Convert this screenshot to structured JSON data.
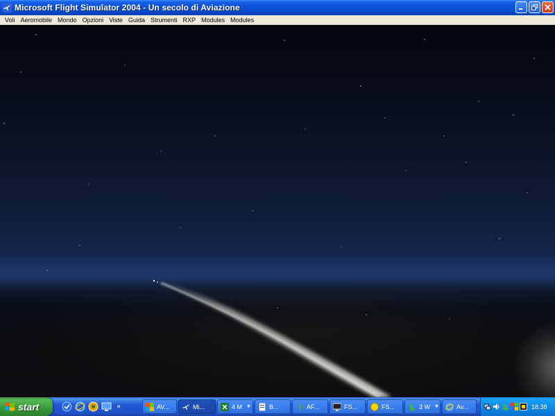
{
  "window": {
    "title": "Microsoft Flight Simulator 2004 - Un secolo di Aviazione",
    "icon": "flight-sim-icon",
    "controls": [
      "minimize-icon",
      "restore-icon",
      "close-icon"
    ]
  },
  "menu": {
    "items": [
      {
        "label": "Voli"
      },
      {
        "label": "Aeromobile"
      },
      {
        "label": "Mondo"
      },
      {
        "label": "Opzioni"
      },
      {
        "label": "Viste"
      },
      {
        "label": "Guida"
      },
      {
        "label": "Strumenti"
      },
      {
        "label": "RXP"
      },
      {
        "label": "Modules"
      },
      {
        "label": "Modules"
      }
    ]
  },
  "scene": {
    "description_icon": "night-sky-scene",
    "colors": {
      "sky_top": "#04060c",
      "horizon": "#1a3462",
      "ground": "#0d0d10",
      "trail": "#d8d6cf"
    }
  },
  "taskbar": {
    "start_label": "start",
    "quicklaunch": [
      "outlook-express-icon",
      "internet-explorer-icon",
      "media-icon",
      "desktop-icon"
    ],
    "quicklaunch_more": "»",
    "tasks": [
      {
        "label": "AV...",
        "icon": "windows-app-icon",
        "active": false
      },
      {
        "label": "Mi...",
        "icon": "flight-sim-icon",
        "active": true
      },
      {
        "label": "4 M",
        "icon": "excel-icon",
        "active": false,
        "group": true
      },
      {
        "label": "B...",
        "icon": "document-icon",
        "active": false
      },
      {
        "label": "AF...",
        "icon": "plane-icon",
        "active": false
      },
      {
        "label": "FS...",
        "icon": "monitor-icon",
        "active": false
      },
      {
        "label": "FS...",
        "icon": "yellow-circle-icon",
        "active": false
      },
      {
        "label": "3 W",
        "icon": "messenger-icon",
        "active": false,
        "group": true
      },
      {
        "label": "Av...",
        "icon": "internet-explorer-icon",
        "active": false
      }
    ],
    "clock": "18.38"
  },
  "tray_icons": [
    "network-icon",
    "volume-icon",
    "messenger-tray-icon",
    "security-icon",
    "antivirus-icon"
  ]
}
